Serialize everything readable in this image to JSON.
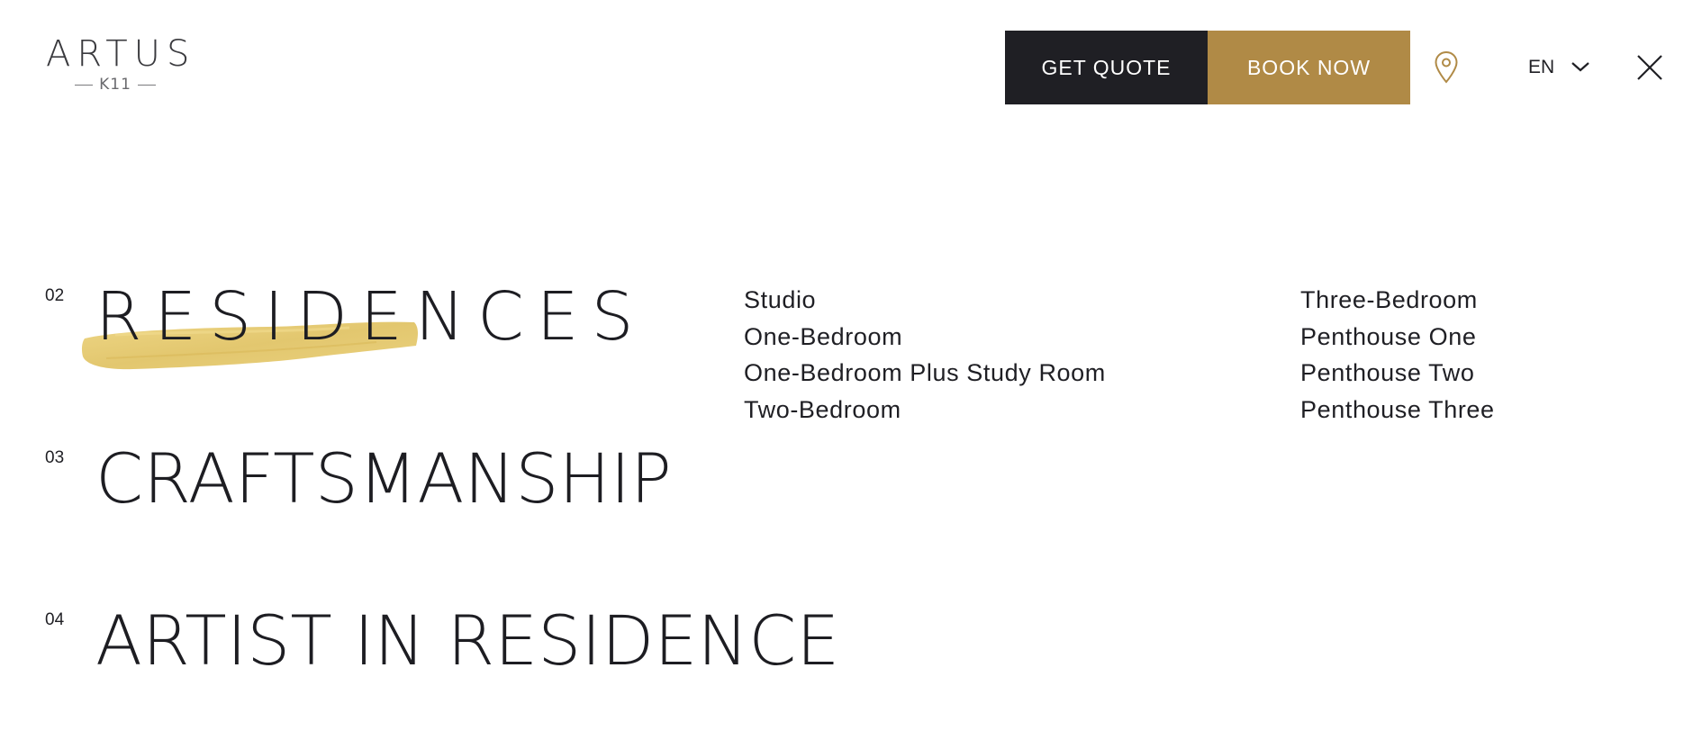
{
  "brand": {
    "name": "ARTUS",
    "sub": "K11"
  },
  "header": {
    "get_quote": "GET QUOTE",
    "book_now": "BOOK NOW",
    "language": "EN",
    "icons": {
      "location": "map-pin-icon",
      "chevron": "chevron-down-icon",
      "close": "close-icon"
    }
  },
  "colors": {
    "dark": "#1f1f24",
    "gold": "#b08a46",
    "brush": "#e2c66a"
  },
  "menu": {
    "items": [
      {
        "number": "02",
        "title": "RESIDENCES",
        "active": true
      },
      {
        "number": "03",
        "title": "CRAFTSMANSHIP",
        "active": false
      },
      {
        "number": "04",
        "title": "ARTIST IN RESIDENCE",
        "active": false
      }
    ],
    "residences_sub": {
      "col1": [
        "Studio",
        "One-Bedroom",
        "One-Bedroom Plus Study Room",
        "Two-Bedroom"
      ],
      "col2": [
        "Three-Bedroom",
        "Penthouse One",
        "Penthouse Two",
        "Penthouse Three"
      ]
    }
  }
}
